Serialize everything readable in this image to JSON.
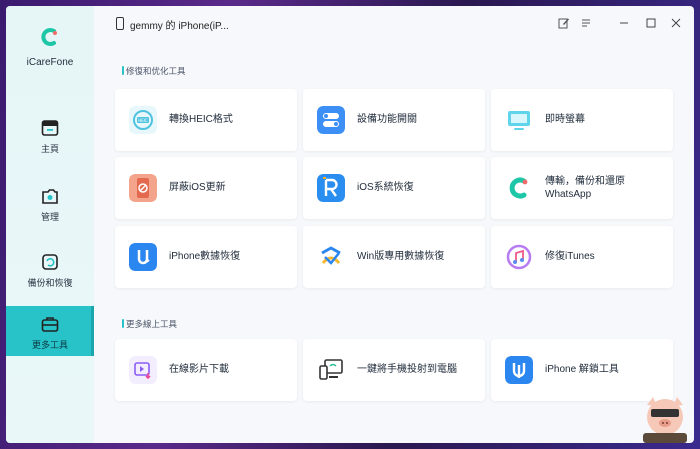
{
  "app": {
    "name": "iCareFone"
  },
  "device": {
    "name": "gemmy 的 iPhone(iP..."
  },
  "sidebar": {
    "items": [
      {
        "label": "主頁",
        "icon": "home-icon"
      },
      {
        "label": "管理",
        "icon": "manage-icon"
      },
      {
        "label": "備份和恢復",
        "icon": "backup-restore-icon"
      },
      {
        "label": "更多工具",
        "icon": "toolbox-icon",
        "active": true
      }
    ]
  },
  "sections": {
    "repair": {
      "title": "修復和优化工具"
    },
    "online": {
      "title": "更多線上工具"
    }
  },
  "cards": {
    "heic": "轉換HEIC格式",
    "switches": "設備功能開關",
    "screen": "即時螢幕",
    "block_update": "屏蔽iOS更新",
    "ios_repair": "iOS系統恢復",
    "whatsapp_1": "傳輸，備份和還原",
    "whatsapp_2": "WhatsApp",
    "iphone_recovery": "iPhone數據恢復",
    "win_recovery": "Win版專用數據恢復",
    "itunes": "修復iTunes",
    "video_download": "在線影片下載",
    "mirror": "一鍵將手機投射到電腦",
    "unlock": "iPhone 解鎖工具"
  },
  "colors": {
    "accent": "#27c3c8",
    "sidebar_bg": "#e6f6f7"
  }
}
